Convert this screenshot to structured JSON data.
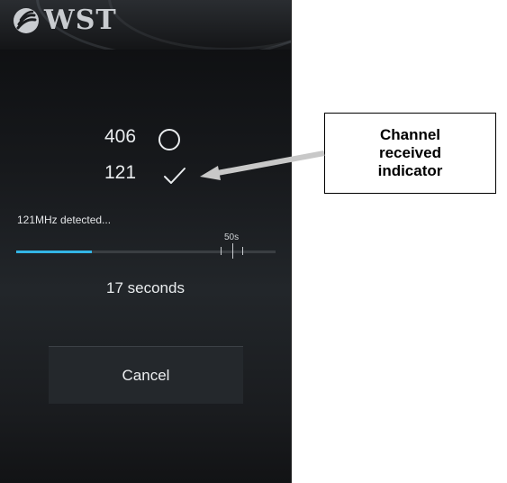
{
  "header": {
    "logo_text": "WST"
  },
  "channels": [
    {
      "number": "406",
      "state": "pending",
      "icon": "circle-icon"
    },
    {
      "number": "121",
      "state": "received",
      "icon": "check-icon"
    }
  ],
  "status": {
    "message": "121MHz detected...",
    "timeout_label": "50s",
    "progress_fraction": 0.29,
    "elapsed_text": "17 seconds"
  },
  "actions": {
    "cancel_label": "Cancel"
  },
  "annotation": {
    "text": "Channel\nreceived\nindicator"
  },
  "colors": {
    "accent": "#33b5e5",
    "screen_background": "#1a1c1f",
    "annotation_arrow": "#c8c8c8"
  }
}
